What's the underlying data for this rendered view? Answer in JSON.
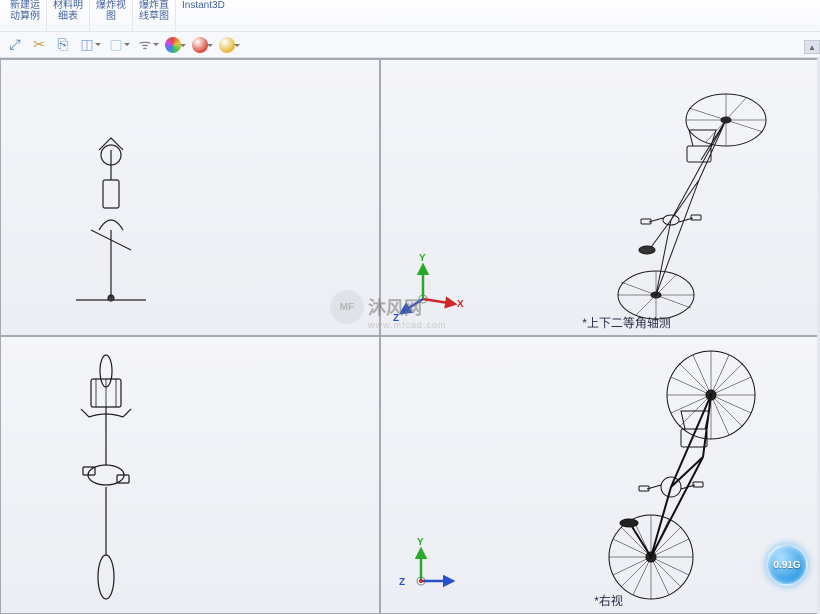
{
  "ribbon": {
    "groups": [
      {
        "label": "新建运\n动算例"
      },
      {
        "label": "材料明\n细表"
      },
      {
        "label": "爆炸视\n图"
      },
      {
        "label": "爆炸直\n线草图"
      },
      {
        "label": "Instant3D"
      }
    ]
  },
  "toolbar": {
    "icons": [
      {
        "name": "zoom-extents-icon",
        "glyph": "⤢",
        "color": "#4a7fb5"
      },
      {
        "name": "section-icon",
        "glyph": "✂",
        "color": "#c79a3a"
      },
      {
        "name": "copy-icon",
        "glyph": "⎘",
        "color": "#4a7fb5"
      },
      {
        "name": "view-orientation-icon",
        "glyph": "◫",
        "color": "#7a9ed6",
        "dropdown": true
      },
      {
        "name": "display-style-icon",
        "glyph": "▢",
        "color": "#a6c6ee",
        "dropdown": true
      },
      {
        "name": "hide-show-icon",
        "glyph": "ᯤ",
        "color": "#888",
        "dropdown": true
      },
      {
        "name": "appearances-icon",
        "glyph": "●",
        "color_grad": "multi",
        "dropdown": true
      },
      {
        "name": "scene-icon",
        "glyph": "●",
        "color": "#d94a3a",
        "dropdown": true
      },
      {
        "name": "render-icon",
        "glyph": "●",
        "color": "#e6b83a",
        "dropdown": true
      }
    ]
  },
  "viewports": {
    "top_left": {
      "label": ""
    },
    "top_right": {
      "label": "*上下二等角轴测"
    },
    "bottom_left": {
      "label": ""
    },
    "bottom_right": {
      "label": "*右视"
    }
  },
  "triad": {
    "x": "X",
    "y": "Y",
    "z": "Z"
  },
  "watermark": {
    "logo_text": "MF",
    "text": "沐风网",
    "sub": "www.mfcad.com"
  },
  "badge": {
    "text": "0.91G"
  }
}
